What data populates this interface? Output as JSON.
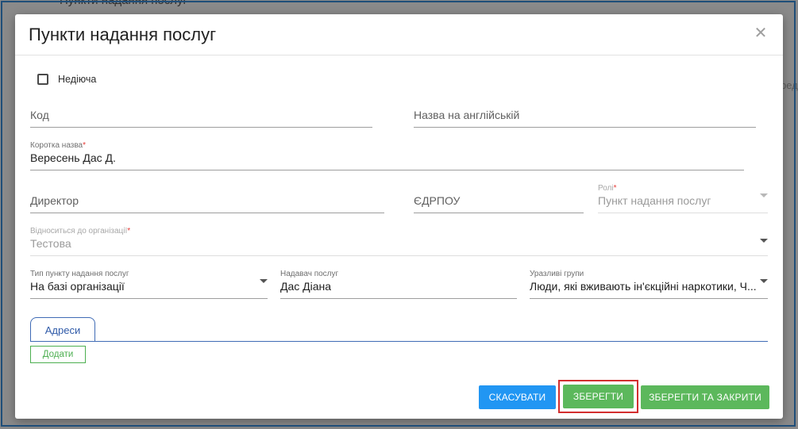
{
  "backdrop": {
    "title": "Пункти надання послуг",
    "hint": "ред"
  },
  "modal": {
    "title": "Пункти надання послуг",
    "close_icon": "close-icon",
    "inactive": {
      "label": "Недіюча",
      "checked": false
    },
    "fields": {
      "code": {
        "placeholder": "Код"
      },
      "name_en": {
        "placeholder": "Назва на англійській"
      },
      "short_name": {
        "label": "Коротка назва",
        "required": "*",
        "value": "Вересень Дас Д."
      },
      "director": {
        "placeholder": "Директор"
      },
      "edrpou": {
        "placeholder": "ЄДРПОУ"
      },
      "roles": {
        "label": "Ролі",
        "required": "*",
        "value": "Пункт надання послуг"
      },
      "organization": {
        "label": "Відноситься до організації",
        "required": "*",
        "value": "Тестова"
      },
      "point_type": {
        "label": "Тип пункту надання послуг",
        "value": "На базі організації"
      },
      "provider": {
        "label": "Надавач послуг",
        "value": "Дас Діана"
      },
      "vulnerable": {
        "label": "Уразливі групи",
        "value": "Люди, які вживають ін'єкційні наркотики, Ч..."
      }
    },
    "tabs": [
      {
        "label": "Адреси"
      }
    ],
    "add_button": "Додати",
    "buttons": {
      "cancel": "СКАСУВАТИ",
      "save": "ЗБЕРЕГТИ",
      "save_close": "ЗБЕРЕГТИ ТА ЗАКРИТИ"
    }
  },
  "colors": {
    "primary": "#2196f3",
    "success": "#5cb85c",
    "accent_tab": "#3f6bb5",
    "highlight": "#d32f2f",
    "required": "#e53935"
  }
}
